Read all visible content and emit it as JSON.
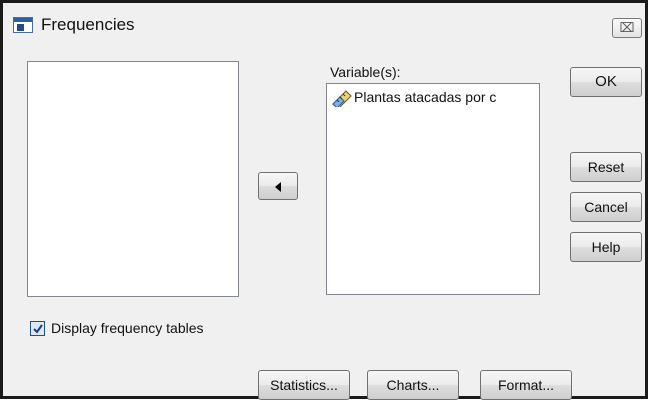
{
  "window": {
    "title": "Frequencies",
    "close_glyph": "⌧"
  },
  "icons": {
    "app": "spss-dialog-icon",
    "close": "close-icon",
    "variable": "scale-ruler-icon",
    "move": "arrow-left-icon"
  },
  "source_list": {
    "items": []
  },
  "target": {
    "label": "Variable(s):",
    "items": [
      {
        "label": "Plantas atacadas por c"
      }
    ]
  },
  "buttons": {
    "ok": "OK",
    "reset": "Reset",
    "cancel": "Cancel",
    "help": "Help",
    "statistics": "Statistics...",
    "charts": "Charts...",
    "format": "Format..."
  },
  "checkbox": {
    "label": "Display frequency tables",
    "checked": true
  },
  "colors": {
    "dialog_bg": "#f0f0f0",
    "border": "#1b1b1b",
    "check_blue": "#1c5180"
  }
}
